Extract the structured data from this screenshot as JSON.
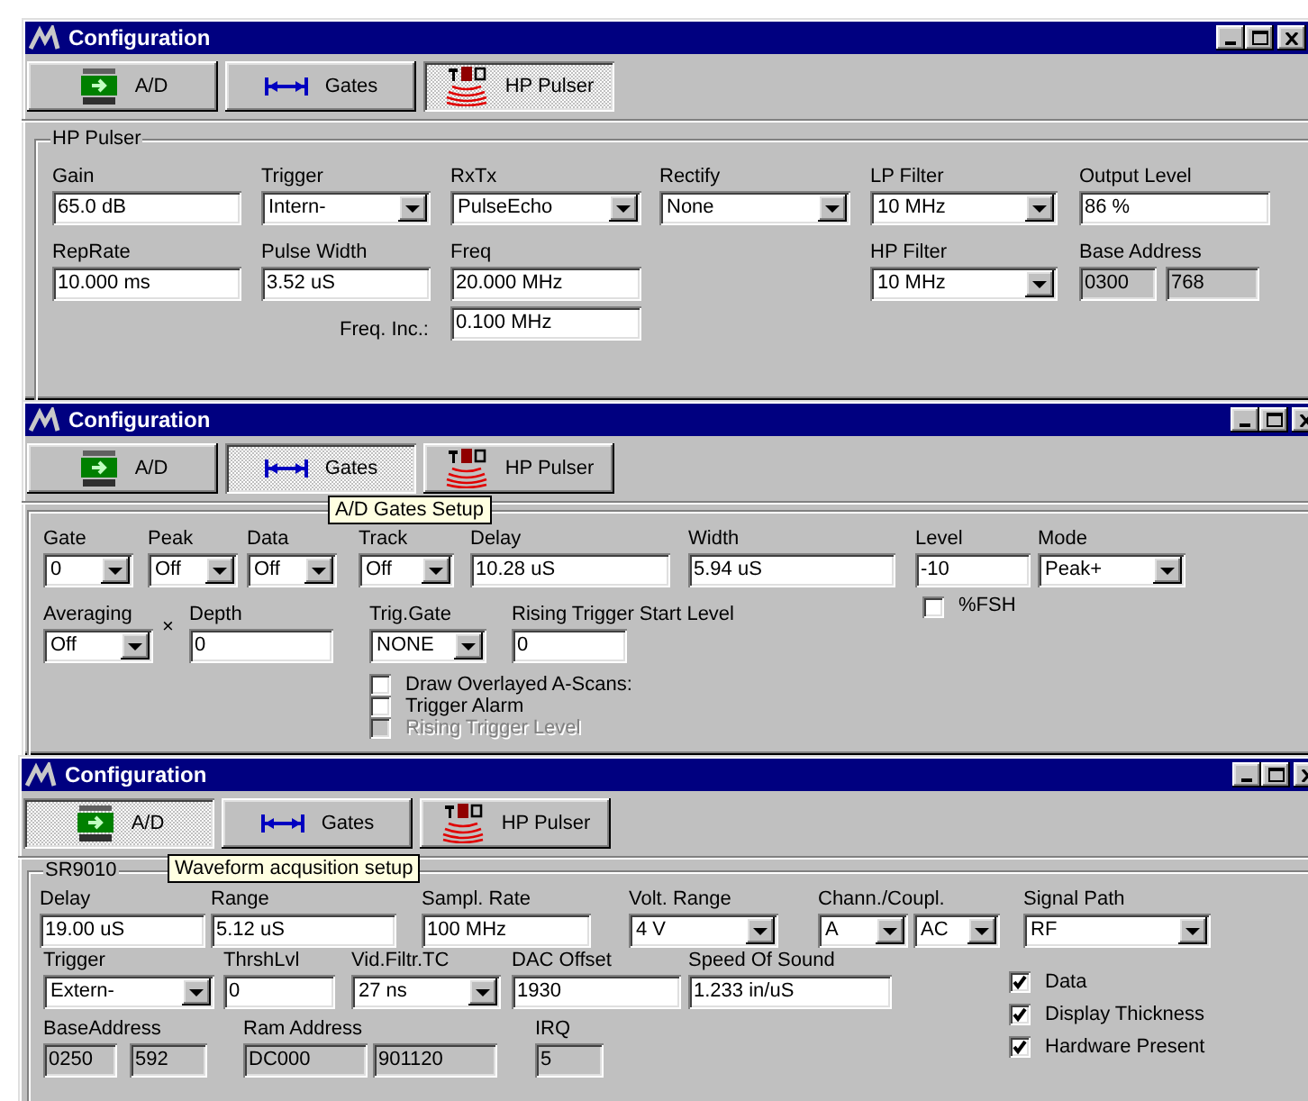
{
  "windows": [
    {
      "title": "Configuration",
      "tabs": [
        {
          "label": "A/D",
          "selected": false
        },
        {
          "label": "Gates",
          "selected": false
        },
        {
          "label": "HP Pulser",
          "selected": true
        }
      ],
      "group": {
        "title": "HP Pulser",
        "rows": [
          [
            {
              "kind": "text",
              "label": "Gain",
              "value": "65.0 dB"
            },
            {
              "kind": "combo",
              "label": "Trigger",
              "value": "Intern-"
            },
            {
              "kind": "combo",
              "label": "RxTx",
              "value": "PulseEcho"
            },
            {
              "kind": "combo",
              "label": "Rectify",
              "value": "None"
            },
            {
              "kind": "combo",
              "label": "LP Filter",
              "value": "10 MHz"
            },
            {
              "kind": "text",
              "label": "Output Level",
              "value": "86 %"
            }
          ],
          [
            {
              "kind": "text",
              "label": "RepRate",
              "value": "10.000 ms"
            },
            {
              "kind": "text",
              "label": "Pulse Width",
              "value": "3.52 uS"
            },
            {
              "kind": "text",
              "label": "Freq",
              "value": "20.000 MHz"
            },
            "",
            {
              "kind": "combo",
              "label": "HP Filter",
              "value": "10 MHz"
            },
            {
              "kind": "pair",
              "label": "Base Address",
              "values": [
                "0300",
                "768"
              ]
            }
          ],
          [
            "",
            "",
            {
              "kind": "inline",
              "label": "Freq. Inc.:",
              "value": "0.100 MHz"
            }
          ]
        ]
      }
    },
    {
      "title": "Configuration",
      "tabs": [
        {
          "label": "A/D",
          "selected": false
        },
        {
          "label": "Gates",
          "selected": true
        },
        {
          "label": "HP Pulser",
          "selected": false
        }
      ],
      "tooltip": "A/D Gates Setup",
      "group": {
        "rows": [
          [
            {
              "kind": "combo",
              "label": "Gate",
              "value": "0"
            },
            {
              "kind": "combo",
              "label": "Peak",
              "value": "Off"
            },
            {
              "kind": "combo",
              "label": "Data",
              "value": "Off"
            },
            {
              "kind": "combo",
              "label": "Track",
              "value": "Off"
            },
            {
              "kind": "text",
              "label": "Delay",
              "value": "10.28 uS"
            },
            {
              "kind": "text",
              "label": "Width",
              "value": "5.94 uS"
            },
            {
              "kind": "text",
              "label": "Level",
              "value": "-10",
              "check": {
                "label": "%FSH",
                "checked": false
              }
            },
            {
              "kind": "combo",
              "label": "Mode",
              "value": "Peak+"
            }
          ],
          [
            {
              "kind": "combo",
              "label": "Averaging",
              "value": "Off"
            },
            {
              "kind": "mark",
              "text": "×"
            },
            {
              "kind": "text",
              "label": "Depth",
              "value": "0"
            },
            {
              "kind": "combo",
              "label": "Trig.Gate",
              "value": "NONE"
            },
            {
              "kind": "text",
              "label": "Rising Trigger Start Level",
              "value": "0"
            }
          ],
          [
            {
              "kind": "checks",
              "items": [
                {
                  "label": "Draw Overlayed A-Scans:",
                  "checked": false,
                  "disabled": false
                },
                {
                  "label": "Trigger Alarm",
                  "checked": false,
                  "disabled": false
                },
                {
                  "label": "Rising Trigger Level",
                  "checked": false,
                  "disabled": true
                }
              ]
            }
          ]
        ]
      }
    },
    {
      "title": "Configuration",
      "tabs": [
        {
          "label": "A/D",
          "selected": true
        },
        {
          "label": "Gates",
          "selected": false
        },
        {
          "label": "HP Pulser",
          "selected": false
        }
      ],
      "tooltip": "Waveform acqusition setup",
      "group": {
        "title": "SR9010",
        "rows": [
          [
            {
              "kind": "text",
              "label": "Delay",
              "value": "19.00 uS"
            },
            {
              "kind": "text",
              "label": "Range",
              "value": "5.12 uS"
            },
            {
              "kind": "text",
              "label": "Sampl. Rate",
              "value": "100 MHz"
            },
            {
              "kind": "combo",
              "label": "Volt. Range",
              "value": "4 V"
            },
            {
              "kind": "combo-pair",
              "label": "Chann./Coupl.",
              "values": [
                "A",
                "AC"
              ]
            },
            {
              "kind": "combo",
              "label": "Signal Path",
              "value": "RF"
            }
          ],
          [
            {
              "kind": "combo",
              "label": "Trigger",
              "value": "Extern-"
            },
            {
              "kind": "text",
              "label": "ThrshLvl",
              "value": "0"
            },
            {
              "kind": "combo",
              "label": "Vid.Filtr.TC",
              "value": "27 ns"
            },
            {
              "kind": "text",
              "label": "DAC Offset",
              "value": "1930"
            },
            {
              "kind": "text",
              "label": "Speed Of Sound",
              "value": "1.233 in/uS"
            },
            {
              "kind": "checks",
              "items": [
                {
                  "label": "Data",
                  "checked": true
                },
                {
                  "label": "Display Thickness",
                  "checked": true
                },
                {
                  "label": "Hardware Present",
                  "checked": true
                }
              ]
            }
          ],
          [
            {
              "kind": "pair",
              "label": "BaseAddress",
              "values": [
                "0250",
                "592"
              ]
            },
            {
              "kind": "pair",
              "label": "Ram Address",
              "values": [
                "DC000",
                "901120"
              ]
            },
            {
              "kind": "readonly",
              "label": "IRQ",
              "value": "5"
            }
          ]
        ]
      }
    }
  ]
}
